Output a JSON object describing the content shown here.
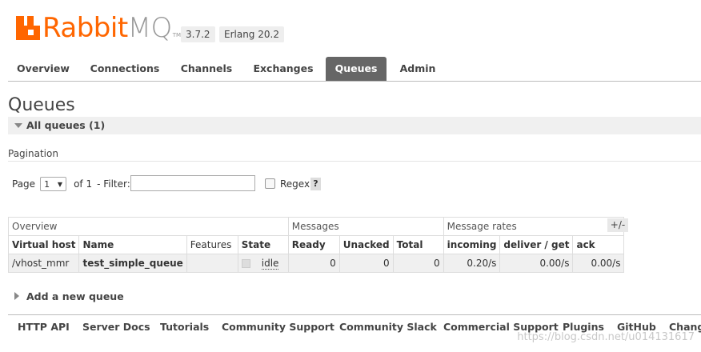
{
  "header": {
    "logo_rabbit": "Rabbit",
    "logo_mq": "MQ",
    "logo_tm": "TM",
    "version": "3.7.2",
    "erlang": "Erlang 20.2"
  },
  "nav": {
    "tabs": [
      "Overview",
      "Connections",
      "Channels",
      "Exchanges",
      "Queues",
      "Admin"
    ],
    "active": "Queues"
  },
  "page": {
    "title": "Queues",
    "section": "All queues (1)"
  },
  "pagination": {
    "label": "Pagination",
    "page_label": "Page",
    "page_value": "1",
    "of_text": "of 1",
    "filter_label": "- Filter:",
    "filter_value": "",
    "regex_label": "Regex",
    "help": "?"
  },
  "table": {
    "groups": [
      "Overview",
      "Messages",
      "Message rates"
    ],
    "columns": [
      "Virtual host",
      "Name",
      "Features",
      "State",
      "Ready",
      "Unacked",
      "Total",
      "incoming",
      "deliver / get",
      "ack"
    ],
    "plusminus": "+/-",
    "rows": [
      {
        "vhost": "/vhost_mmr",
        "name": "test_simple_queue",
        "features": "",
        "state": "idle",
        "ready": "0",
        "unacked": "0",
        "total": "0",
        "incoming": "0.20/s",
        "deliver_get": "0.00/s",
        "ack": "0.00/s"
      }
    ]
  },
  "add_queue": "Add a new queue",
  "footer": {
    "links": [
      "HTTP API",
      "Server Docs",
      "Tutorials",
      "Community Support",
      "Community Slack",
      "Commercial Support",
      "Plugins",
      "GitHub",
      "Changelog"
    ]
  },
  "watermark": "https://blog.csdn.net/u014131617",
  "colors": {
    "brand": "#ff6600",
    "active_tab": "#666666",
    "row_bg": "#f0f0f0"
  }
}
